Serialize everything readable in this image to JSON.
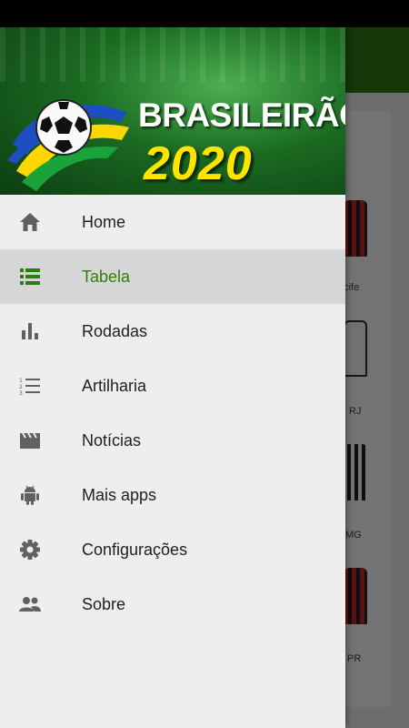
{
  "colors": {
    "accent": "#2e7d12",
    "toolbar": "#2e7d12",
    "icon_gray": "#616161",
    "logo_year_yellow": "#ffe400"
  },
  "background_app": {
    "team_labels": [
      "ecife",
      "RJ",
      "MG",
      "PR"
    ]
  },
  "drawer": {
    "header": {
      "title": "BRASILEIRÃO",
      "year": "2020",
      "logo_icon": "soccer-ball-icon"
    },
    "items": [
      {
        "label": "Home",
        "icon": "home-icon",
        "active": false
      },
      {
        "label": "Tabela",
        "icon": "table-list-icon",
        "active": true
      },
      {
        "label": "Rodadas",
        "icon": "bar-chart-icon",
        "active": false
      },
      {
        "label": "Artilharia",
        "icon": "numbered-list-icon",
        "active": false
      },
      {
        "label": "Notícias",
        "icon": "clapperboard-icon",
        "active": false
      },
      {
        "label": "Mais apps",
        "icon": "android-icon",
        "active": false
      },
      {
        "label": "Configurações",
        "icon": "gear-icon",
        "active": false
      },
      {
        "label": "Sobre",
        "icon": "people-icon",
        "active": false
      }
    ]
  }
}
